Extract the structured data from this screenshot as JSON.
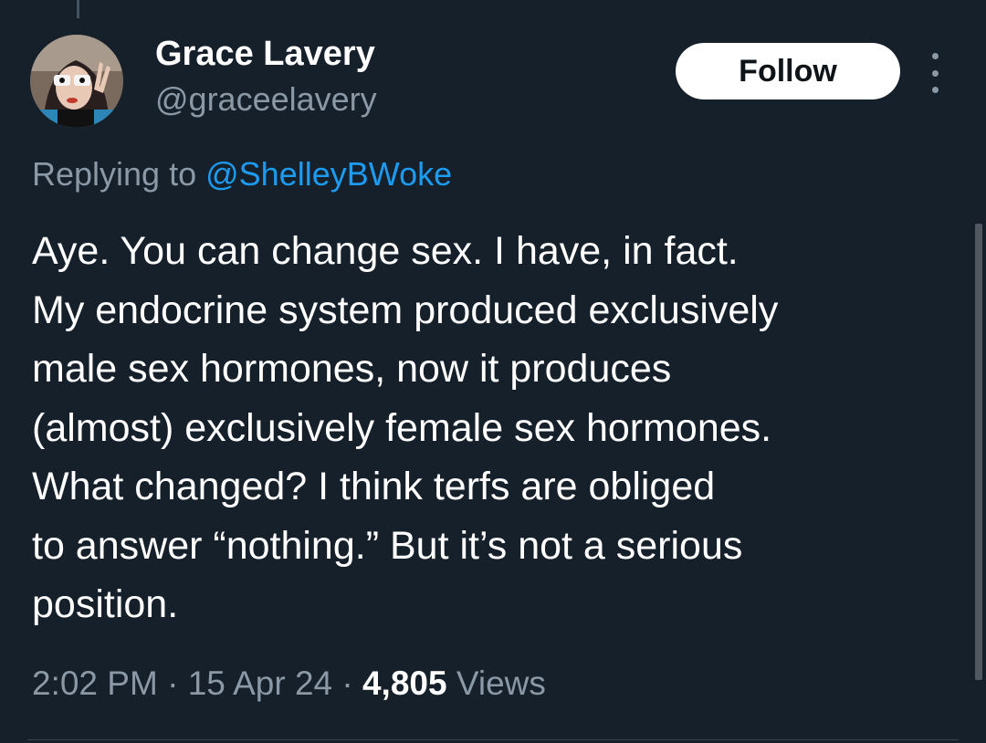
{
  "author": {
    "display_name": "Grace Lavery",
    "handle": "@graceelavery",
    "follow_label": "Follow"
  },
  "reply": {
    "prefix": "Replying to",
    "handle": "@ShelleyBWoke"
  },
  "tweet": {
    "lines": [
      "Aye. You can change sex. I have, in fact.",
      "My endocrine system produced exclusively",
      "male sex hormones, now it produces",
      "(almost) exclusively female sex hormones.",
      "What changed? I think terfs are obliged",
      "to answer “nothing.” But it’s not a serious",
      "position."
    ]
  },
  "meta": {
    "time": "2:02 PM",
    "separator": "·",
    "date": "15 Apr 24",
    "views_count": "4,805",
    "views_label": "Views"
  },
  "icons": {
    "more": "more-vertical-icon"
  },
  "colors": {
    "background": "#15202b",
    "text_primary": "#ffffff",
    "text_secondary": "#8b98a5",
    "link": "#1d9bf0",
    "follow_bg": "#ffffff"
  }
}
